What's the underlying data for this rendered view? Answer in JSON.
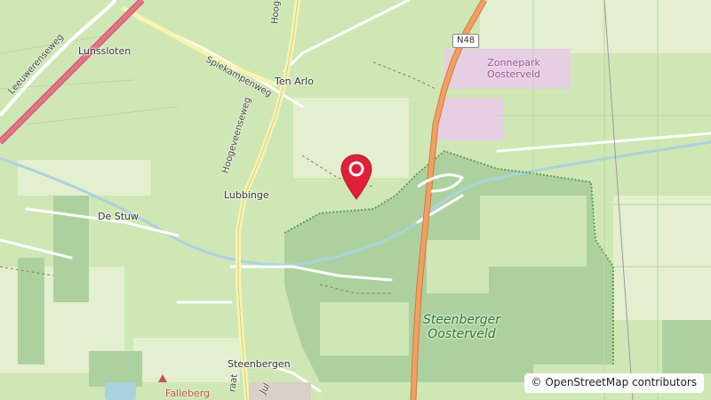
{
  "places": {
    "lunssloten": "Lunssloten",
    "ten_arlo": "Ten Arlo",
    "lubbinge": "Lubbinge",
    "de_stuw": "De Stuw",
    "steenbergen": "Steenbergen"
  },
  "roads": {
    "spiekampenweg": "Spiekampenweg",
    "hoogeveenseweg": "Hoogeveenseweg",
    "hoogeve_top": "Hoogeve",
    "leeuwerenseweg": "Leeuwerenseweg",
    "raat": "raat",
    "jul": "Jul",
    "shield": "N48"
  },
  "areas": {
    "zonnepark_line1": "Zonnepark",
    "zonnepark_line2": "Oosterveld",
    "nature_line1": "Steenberger",
    "nature_line2": "Oosterveld",
    "falieberg": "Falieberg"
  },
  "attribution": {
    "symbol": "©",
    "link": "OpenStreetMap contributors"
  },
  "colors": {
    "land": "#cfe7b4",
    "forest": "#add19e",
    "motorway": "#e8928f",
    "trunk": "#f2a062",
    "marker": "#e0203a",
    "park_purple": "#e6cfe2"
  }
}
